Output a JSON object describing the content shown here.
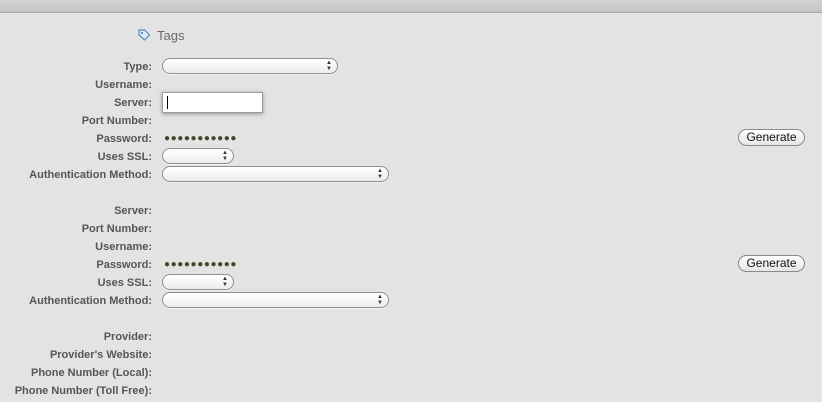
{
  "tags": {
    "label": "Tags",
    "icon": "tag-icon"
  },
  "server_section": {
    "type_label": "Type:",
    "username_label": "Username:",
    "server_label": "Server:",
    "server_value": "",
    "port_label": "Port Number:",
    "password_label": "Password:",
    "password_mask": "●●●●●●●●●●●",
    "ssl_label": "Uses SSL:",
    "auth_label": "Authentication Method:",
    "generate_label": "Generate"
  },
  "server_section_2": {
    "server_label": "Server:",
    "port_label": "Port Number:",
    "username_label": "Username:",
    "password_label": "Password:",
    "password_mask": "●●●●●●●●●●●",
    "ssl_label": "Uses SSL:",
    "auth_label": "Authentication Method:",
    "generate_label": "Generate"
  },
  "provider_section": {
    "provider_label": "Provider:",
    "website_label": "Provider's Website:",
    "phone_local_label": "Phone Number (Local):",
    "phone_tollfree_label": "Phone Number (Toll Free):"
  }
}
